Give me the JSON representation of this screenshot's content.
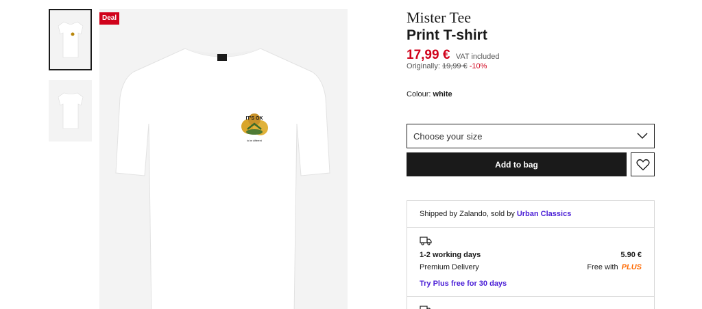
{
  "gallery": {
    "thumbnails": [
      {
        "alt": "front view"
      },
      {
        "alt": "back view"
      }
    ],
    "badge": "Deal",
    "shirt_print_top": "IT'S OK",
    "shirt_print_bottom": "to be different"
  },
  "product": {
    "brand": "Mister Tee",
    "name": "Print T-shirt",
    "price": "17,99 €",
    "vat_note": "VAT included",
    "original_label": "Originally:",
    "original_price": "19,99 €",
    "discount": "-10%",
    "colour_label": "Colour:",
    "colour_value": "white"
  },
  "actions": {
    "size_placeholder": "Choose your size",
    "add_to_bag": "Add to bag"
  },
  "delivery": {
    "shipped_text": "Shipped by Zalando, sold by",
    "seller": "Urban Classics",
    "days": "1-2 working days",
    "price": "5.90 €",
    "type": "Premium Delivery",
    "free_with": "Free with",
    "plus_label": "PLUS",
    "try_plus": "Try Plus free for 30 days"
  },
  "colors": {
    "accent_red": "#d0021b",
    "link_purple": "#4a1ed6",
    "plus_orange": "#ff6900"
  }
}
